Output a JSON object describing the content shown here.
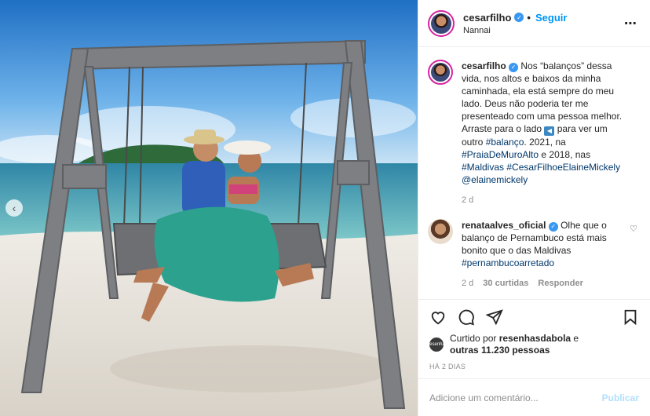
{
  "header": {
    "username": "cesarfilho",
    "follow_label": "Seguir",
    "location": "Nannai",
    "more_icon": "⋯"
  },
  "media": {
    "prev_icon": "‹"
  },
  "caption": {
    "username": "cesarfilho",
    "text_1": "Nos “balanços” dessa vida, nos altos e baixos da minha caminhada, ela está sempre do meu lado. Deus não poderia ter me presenteado com uma pessoa melhor. Arraste para o lado ",
    "arrow_emoji": "◀",
    "text_2": " para ver um outro ",
    "tag_1": "#balanço",
    "text_3": ". 2021, na ",
    "tag_2": "#PraiaDeMuroAlto",
    "text_4": " e 2018, nas ",
    "tag_3": "#Maldivas",
    "tag_4": "#CesarFilhoeElaineMickely",
    "mention": "@elainemickely",
    "time": "2 d"
  },
  "comment": {
    "username": "renataalves_oficial",
    "text": "Olhe que o balanço de Pernambuco está mais bonito que o das Maldivas ",
    "tag": "#pernambucoarretado",
    "time": "2 d",
    "likes": "30 curtidas",
    "reply": "Responder"
  },
  "likes": {
    "prefix": "Curtido por ",
    "user": "resenhasdabola",
    "mid": " e",
    "others": "outras 11.230 pessoas",
    "avatar_text": "resenha"
  },
  "time_ago": "HÁ 2 DIAS",
  "add_comment": {
    "placeholder": "Adicione um comentário...",
    "publish_label": "Publicar"
  },
  "colors": {
    "accent": "#0095f6",
    "verified": "#3897f0",
    "link": "#00376b"
  }
}
